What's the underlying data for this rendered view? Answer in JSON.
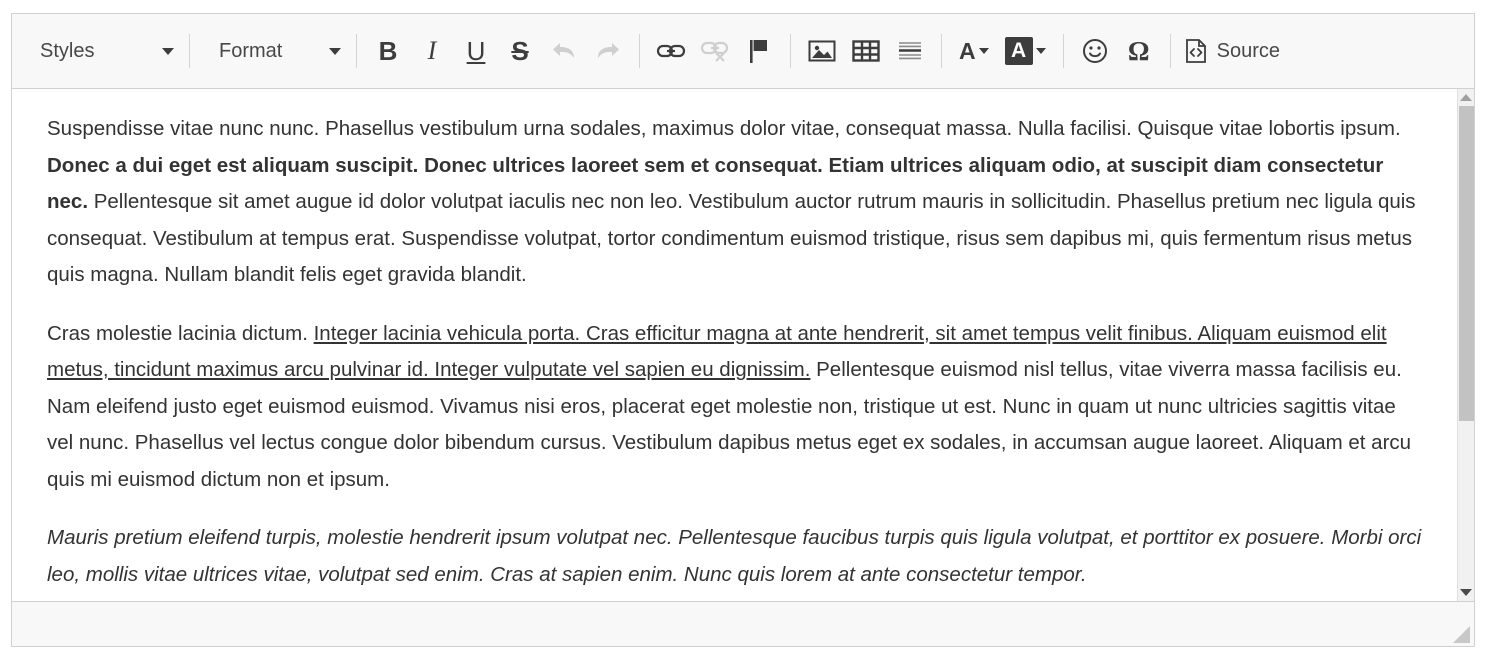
{
  "toolbar": {
    "styles_dropdown": {
      "label": "Styles",
      "icon": "chevron-down-icon"
    },
    "format_dropdown": {
      "label": "Format",
      "icon": "chevron-down-icon"
    },
    "buttons": [
      {
        "name": "bold-button",
        "glyph": "B",
        "label": "Bold",
        "enabled": true
      },
      {
        "name": "italic-button",
        "glyph": "I",
        "label": "Italic",
        "enabled": true
      },
      {
        "name": "underline-button",
        "glyph": "U",
        "label": "Underline",
        "enabled": true
      },
      {
        "name": "strikethrough-button",
        "glyph": "S",
        "label": "Strikethrough",
        "enabled": true
      },
      {
        "name": "undo-button",
        "glyph": "↰",
        "label": "Undo",
        "enabled": false
      },
      {
        "name": "redo-button",
        "glyph": "↱",
        "label": "Redo",
        "enabled": false
      },
      {
        "name": "link-button",
        "glyph": "🔗",
        "label": "Link",
        "enabled": true
      },
      {
        "name": "unlink-button",
        "glyph": "⛓",
        "label": "Unlink",
        "enabled": false
      },
      {
        "name": "anchor-button",
        "glyph": "⚑",
        "label": "Anchor",
        "enabled": true
      },
      {
        "name": "image-button",
        "glyph": "🖼",
        "label": "Image",
        "enabled": true
      },
      {
        "name": "table-button",
        "glyph": "▦",
        "label": "Table",
        "enabled": true
      },
      {
        "name": "horizontal-rule-button",
        "glyph": "≡",
        "label": "Horizontal Line",
        "enabled": true
      },
      {
        "name": "text-color-button",
        "glyph": "A",
        "label": "Text Color",
        "enabled": true
      },
      {
        "name": "background-color-button",
        "glyph": "A",
        "label": "Background Color",
        "enabled": true
      },
      {
        "name": "smiley-button",
        "glyph": "☺",
        "label": "Smiley",
        "enabled": true
      },
      {
        "name": "special-character-button",
        "glyph": "Ω",
        "label": "Insert Special Character",
        "enabled": true
      }
    ],
    "source_button": {
      "label": "Source",
      "icon": "source-document-icon"
    }
  },
  "content": {
    "paragraphs": [
      {
        "type": "mixed",
        "runs": [
          {
            "style": "normal",
            "text": "Suspendisse vitae nunc nunc. Phasellus vestibulum urna sodales, maximus dolor vitae, consequat massa. Nulla facilisi. Quisque vitae lobortis ipsum. "
          },
          {
            "style": "bold",
            "text": "Donec a dui eget est aliquam suscipit. Donec ultrices laoreet sem et consequat. Etiam ultrices aliquam odio, at suscipit diam consectetur nec."
          },
          {
            "style": "normal",
            "text": " Pellentesque sit amet augue id dolor volutpat iaculis nec non leo. Vestibulum auctor rutrum mauris in sollicitudin. Phasellus pretium nec ligula quis consequat. Vestibulum at tempus erat. Suspendisse volutpat, tortor condimentum euismod tristique, risus sem dapibus mi, quis fermentum risus metus quis magna. Nullam blandit felis eget gravida blandit."
          }
        ]
      },
      {
        "type": "mixed",
        "runs": [
          {
            "style": "normal",
            "text": "Cras molestie lacinia dictum. "
          },
          {
            "style": "underline",
            "text": "Integer lacinia vehicula porta. Cras efficitur magna at ante hendrerit, sit amet tempus velit finibus. Aliquam euismod elit metus, tincidunt maximus arcu pulvinar id. Integer vulputate vel sapien eu dignissim."
          },
          {
            "style": "normal",
            "text": " Pellentesque euismod nisl tellus, vitae viverra massa facilisis eu. Nam eleifend justo eget euismod euismod. Vivamus nisi eros, placerat eget molestie non, tristique ut est. Nunc in quam ut nunc ultricies sagittis vitae vel nunc. Phasellus vel lectus congue dolor bibendum cursus. Vestibulum dapibus metus eget ex sodales, in accumsan augue laoreet. Aliquam et arcu quis mi euismod dictum non et ipsum."
          }
        ]
      },
      {
        "type": "mixed",
        "runs": [
          {
            "style": "italic",
            "text": "Mauris pretium eleifend turpis, molestie hendrerit ipsum volutpat nec. Pellentesque faucibus turpis quis ligula volutpat, et porttitor ex posuere. Morbi orci leo, mollis vitae ultrices vitae, volutpat sed enim. Cras at sapien enim. Nunc quis lorem at ante consectetur tempor."
          }
        ]
      }
    ]
  },
  "scrollbar": {
    "up_arrow_icon": "triangle-up-icon",
    "down_arrow_icon": "triangle-down-icon",
    "thumb_size_percent": 66,
    "thumb_position_percent": 0
  },
  "footer": {
    "status_text": "",
    "resize_grip_icon": "resize-grip-icon"
  },
  "colors": {
    "toolbar_bg": "#f8f8f8",
    "border": "#d1d1d1",
    "text": "#333333",
    "icon": "#3d3d3d",
    "icon_disabled": "#c6c6c6",
    "scrollbar_thumb": "#c2c2c2",
    "scrollbar_track": "#f1f1f1"
  }
}
